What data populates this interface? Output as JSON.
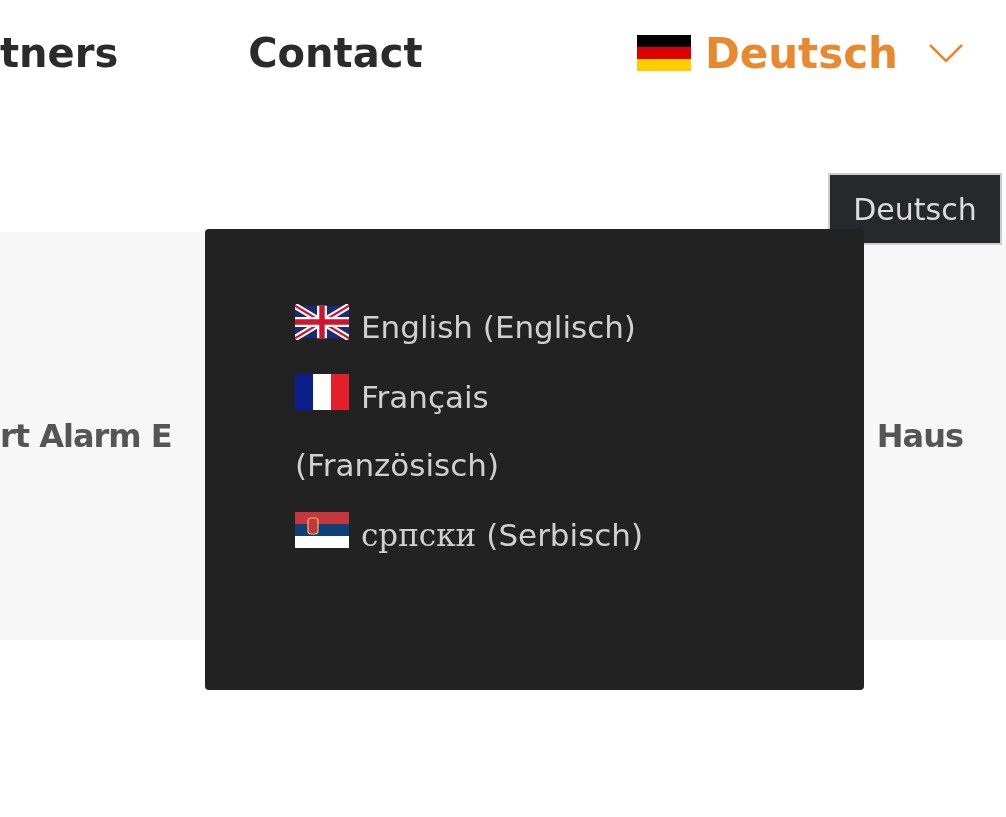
{
  "nav": {
    "items": [
      {
        "label": "tners"
      },
      {
        "label": "Contact"
      }
    ],
    "language": {
      "label": "Deutsch",
      "kind": "de",
      "expanded": true
    }
  },
  "tooltip": "Deutsch",
  "band": {
    "left_text": "rt Alarm E",
    "right_text": "Haus"
  },
  "language_menu": [
    {
      "kind": "gb",
      "label": "English (Englisch)",
      "serif": false
    },
    {
      "kind": "fr",
      "label": "Français (Französisch)",
      "serif": false
    },
    {
      "kind": "rs",
      "label": "српски",
      "label_2": "(Serbisch)",
      "serif": true
    }
  ]
}
